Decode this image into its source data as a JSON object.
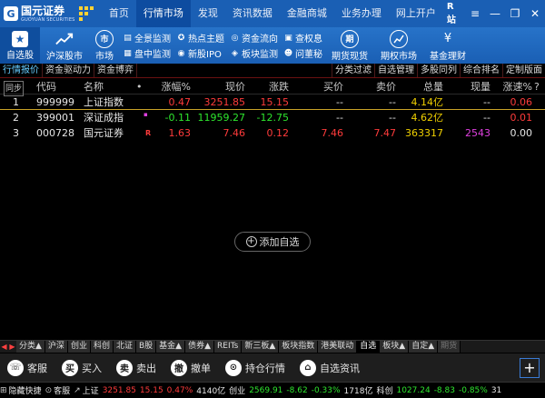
{
  "app": {
    "logo_cn": "国元证券",
    "logo_en": "GUOYUAN SECURITIES",
    "site_badge": "站",
    "site_badge_prefix": "R"
  },
  "menu": [
    {
      "label": "首页",
      "active": false
    },
    {
      "label": "行情市场",
      "active": true
    },
    {
      "label": "发现",
      "active": false
    },
    {
      "label": "资讯数据",
      "active": false
    },
    {
      "label": "金融商城",
      "active": false
    },
    {
      "label": "业务办理",
      "active": false
    },
    {
      "label": "网上开户",
      "active": false
    }
  ],
  "toolbar": {
    "fav_label": "自选股",
    "shsz_label": "沪深股市",
    "market_icon": "市",
    "market_label": "市场",
    "small1": [
      "全景监测",
      "盘中监测"
    ],
    "small2": [
      "热点主题",
      "新股IPO"
    ],
    "small3": [
      "资金流向",
      "板块监测"
    ],
    "small4": [
      "查权息",
      "问董秘"
    ],
    "futures_icon": "期",
    "futures_label": "期货现货",
    "options_label": "期权市场",
    "fund_label": "基金理财"
  },
  "subtabs": {
    "left": [
      "行情报价",
      "资金驱动力",
      "资金博弈"
    ],
    "right": [
      "分类过滤",
      "自选管理",
      "多股同列",
      "综合排名",
      "定制版面"
    ]
  },
  "table": {
    "sync_label": "同步",
    "headers": {
      "code": "代码",
      "name": "名称",
      "dot": "•",
      "pct": "涨幅%",
      "price": "现价",
      "change": "涨跌",
      "bid": "买价",
      "ask": "卖价",
      "amount": "总量",
      "volume": "现量",
      "speed": "涨速%",
      "help": "?"
    },
    "rows": [
      {
        "idx": "1",
        "code": "999999",
        "name": "上证指数",
        "flag": "",
        "pct": "0.47",
        "price": "3251.85",
        "change": "15.15",
        "bid": "--",
        "ask": "--",
        "amount": "4.14亿",
        "volume": "--",
        "speed": "0.06"
      },
      {
        "idx": "2",
        "code": "399001",
        "name": "深证成指",
        "flag": "▪",
        "pct": "-0.11",
        "price": "11959.27",
        "change": "-12.75",
        "bid": "--",
        "ask": "--",
        "amount": "4.62亿",
        "volume": "--",
        "speed": "0.01"
      },
      {
        "idx": "3",
        "code": "000728",
        "name": "国元证券",
        "flag": "R",
        "pct": "1.63",
        "price": "7.46",
        "change": "0.12",
        "bid": "7.46",
        "ask": "7.47",
        "amount": "363317",
        "volume": "2543",
        "speed": "0.00"
      }
    ]
  },
  "add_fav_label": "添加自选",
  "market_tabs": [
    {
      "label": "分类▲",
      "active": false
    },
    {
      "label": "沪深",
      "active": false
    },
    {
      "label": "创业",
      "active": false
    },
    {
      "label": "科创",
      "active": false
    },
    {
      "label": "北证",
      "active": false
    },
    {
      "label": "B股",
      "active": false
    },
    {
      "label": "基金▲",
      "active": false
    },
    {
      "label": "债券▲",
      "active": false
    },
    {
      "label": "REITs",
      "active": false
    },
    {
      "label": "新三板▲",
      "active": false
    },
    {
      "label": "板块指数",
      "active": false
    },
    {
      "label": "港美联动",
      "active": false
    },
    {
      "label": "自选",
      "active": true
    },
    {
      "label": "板块▲",
      "active": false
    },
    {
      "label": "自定▲",
      "active": false
    },
    {
      "label": "期货",
      "active": false
    }
  ],
  "actions": [
    {
      "icon": "☏",
      "label": "客服"
    },
    {
      "icon": "买",
      "label": "买入"
    },
    {
      "icon": "卖",
      "label": "卖出"
    },
    {
      "icon": "撤",
      "label": "撤单"
    },
    {
      "icon": "⊙",
      "label": "持仓行情"
    },
    {
      "icon": "⌂",
      "label": "自选资讯"
    }
  ],
  "status": {
    "hide_shortcut": "隐藏快捷",
    "service": "客服",
    "sh_name": "上证",
    "sh_price": "3251.85",
    "sh_change": "15.15",
    "sh_pct": "0.47%",
    "sh_amount": "4140亿",
    "cy_name": "创业",
    "cy_price": "2569.91",
    "cy_change": "-8.62",
    "cy_pct": "-0.33%",
    "cy_amount": "1718亿",
    "kc_name": "科创",
    "kc_price": "1027.24",
    "kc_change": "-8.83",
    "kc_pct": "-0.85%",
    "tail": "31"
  },
  "colors": {
    "brand_blue": "#1a5fb4",
    "up_red": "#ff3b3b",
    "down_green": "#2ee52e",
    "amount_yellow": "#f0d000",
    "volume_magenta": "#e040e0"
  }
}
